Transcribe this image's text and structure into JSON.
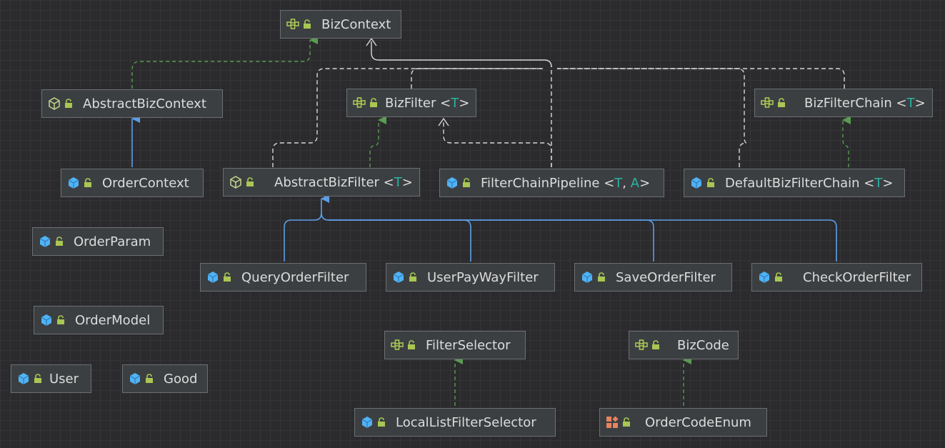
{
  "colors": {
    "class_icon": "#4fb3f6",
    "interface_icon": "#a9c653",
    "abstract_icon": "#c8d68d",
    "enum_icon": "#e8845e",
    "lock_icon": "#a9c653",
    "type_param": "#2ab4a6",
    "extends_edge": "#5c9ee8",
    "implements_edge": "#5a9c52",
    "dependency_edge": "#d8d8d8"
  },
  "nodes": {
    "biz_context": {
      "icon": "interface-icon",
      "name": "BizContext"
    },
    "abstract_biz_context": {
      "icon": "abstract-class-icon",
      "name": "AbstractBizContext"
    },
    "biz_filter": {
      "icon": "interface-icon",
      "name": "BizFilter",
      "type_open": "<",
      "type_params": "T",
      "type_close": ">"
    },
    "biz_filter_chain": {
      "icon": "interface-icon",
      "name": "BizFilterChain",
      "type_open": "<",
      "type_params": "T",
      "type_close": ">"
    },
    "order_context": {
      "icon": "class-icon",
      "name": "OrderContext"
    },
    "abstract_biz_filter": {
      "icon": "abstract-class-icon",
      "name": "AbstractBizFilter",
      "type_open": "<",
      "type_params": "T",
      "type_close": ">"
    },
    "filter_chain_pipeline": {
      "icon": "class-icon",
      "name": "FilterChainPipeline",
      "type_open": "<",
      "type_param_1": "T",
      "type_sep": ", ",
      "type_param_2": "A",
      "type_close": ">"
    },
    "default_biz_filter_chain": {
      "icon": "class-icon",
      "name": "DefaultBizFilterChain",
      "type_open": "<",
      "type_params": "T",
      "type_close": ">"
    },
    "order_param": {
      "icon": "class-icon",
      "name": "OrderParam"
    },
    "query_order_filter": {
      "icon": "class-icon",
      "name": "QueryOrderFilter"
    },
    "user_pay_way_filter": {
      "icon": "class-icon",
      "name": "UserPayWayFilter"
    },
    "save_order_filter": {
      "icon": "class-icon",
      "name": "SaveOrderFilter"
    },
    "check_order_filter": {
      "icon": "class-icon",
      "name": "CheckOrderFilter"
    },
    "order_model": {
      "icon": "class-icon",
      "name": "OrderModel"
    },
    "filter_selector": {
      "icon": "interface-icon",
      "name": "FilterSelector"
    },
    "biz_code": {
      "icon": "interface-icon",
      "name": "BizCode"
    },
    "user": {
      "icon": "class-icon",
      "name": "User"
    },
    "good": {
      "icon": "class-icon",
      "name": "Good"
    },
    "local_list_filter_selector": {
      "icon": "class-icon",
      "name": "LocalListFilterSelector"
    },
    "order_code_enum": {
      "icon": "enum-icon",
      "name": "OrderCodeEnum"
    }
  }
}
